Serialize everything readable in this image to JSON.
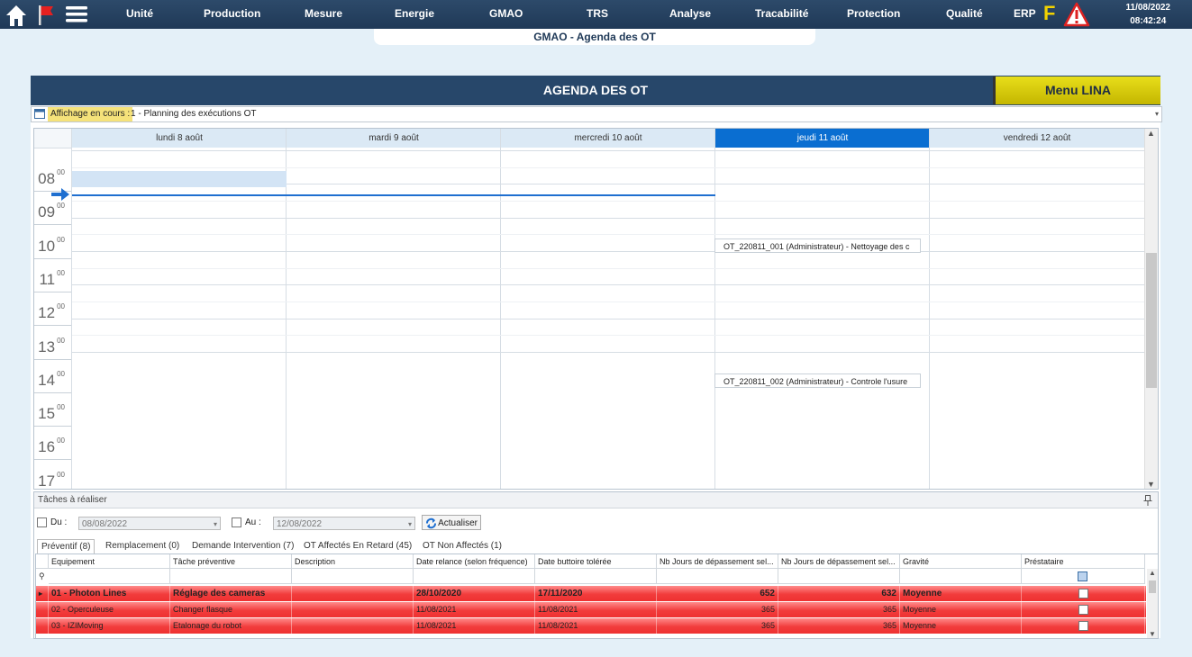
{
  "topbar": {
    "nav": [
      "Unité",
      "Production",
      "Mesure",
      "Energie",
      "GMAO",
      "TRS",
      "Analyse",
      "Tracabilité",
      "Protection",
      "Qualité",
      "ERP"
    ],
    "f_label": "F",
    "date": "11/08/2022",
    "time": "08:42:24"
  },
  "page_subtitle": "GMAO - Agenda des OT",
  "banner": {
    "title": "AGENDA DES OT",
    "menu_button": "Menu LINA"
  },
  "affichage": {
    "label": "Affichage en cours :",
    "value": "1 - Planning des exécutions OT"
  },
  "agenda": {
    "days": [
      "lundi 8 août",
      "mardi 9 août",
      "mercredi 10 août",
      "jeudi 11 août",
      "vendredi 12 août"
    ],
    "selected_day": "jeudi 11 août",
    "hours": [
      "08",
      "09",
      "10",
      "11",
      "12",
      "13",
      "14",
      "15",
      "16",
      "17"
    ],
    "minutes": "00",
    "events": [
      {
        "day": "jeudi 11 août",
        "hour": "09",
        "text": "OT_220811_001 (Administrateur) - Nettoyage des c"
      },
      {
        "day": "jeudi 11 août",
        "hour": "13",
        "text": "OT_220811_002 (Administrateur) - Controle l'usure"
      }
    ]
  },
  "tasks": {
    "title": "Tâches à réaliser",
    "du_label": "Du :",
    "du_value": "08/08/2022",
    "au_label": "Au :",
    "au_value": "12/08/2022",
    "refresh_button": "Actualiser",
    "tabs": [
      "Préventif (8)",
      "Remplacement (0)",
      "Demande Intervention (7)",
      "OT Affectés En Retard (45)",
      "OT Non Affectés (1)"
    ],
    "active_tab": "Préventif (8)",
    "columns": [
      "Equipement",
      "Tâche préventive",
      "Description",
      "Date relance (selon fréquence)",
      "Date buttoire tolérée",
      "Nb Jours de dépassement sel...",
      "Nb Jours de dépassement sel...",
      "Gravité",
      "Préstataire"
    ],
    "rows": [
      [
        "01 - Photon Lines",
        "Réglage des cameras",
        "",
        "28/10/2020",
        "17/11/2020",
        "652",
        "632",
        "Moyenne",
        ""
      ],
      [
        "02 - Operculeuse",
        "Changer flasque",
        "",
        "11/08/2021",
        "11/08/2021",
        "365",
        "365",
        "Moyenne",
        ""
      ],
      [
        "03 - IZIMoving",
        "Etalonage du robot",
        "",
        "11/08/2021",
        "11/08/2021",
        "365",
        "365",
        "Moyenne",
        ""
      ]
    ]
  },
  "colors": {
    "accent": "#0a6ed1",
    "banner": "#27476a",
    "lina": "#d8cc05",
    "overdue_row": "#f23c3c"
  }
}
